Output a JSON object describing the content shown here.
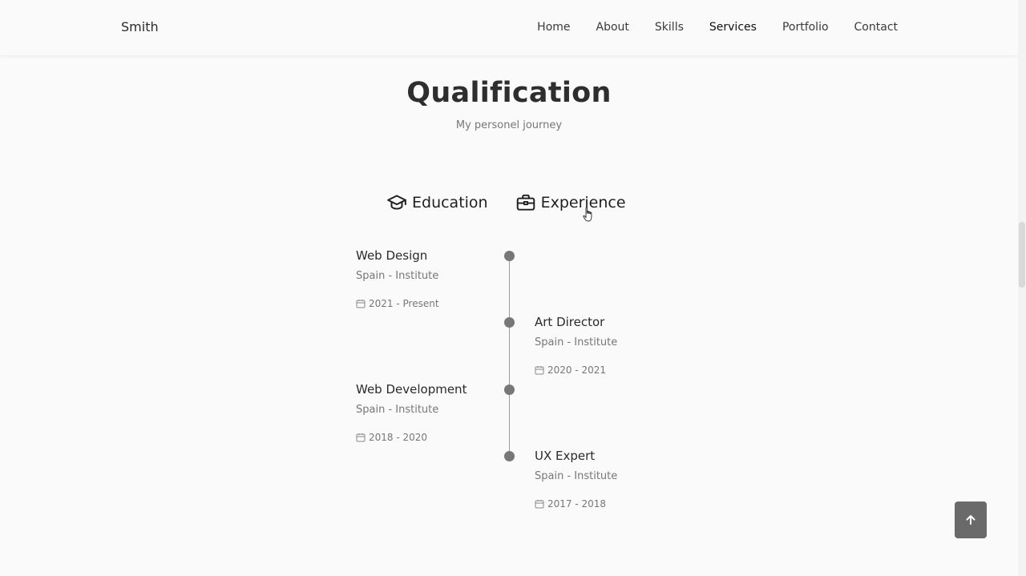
{
  "header": {
    "logo": "Smith",
    "nav": [
      {
        "label": "Home"
      },
      {
        "label": "About"
      },
      {
        "label": "Skills"
      },
      {
        "label": "Services",
        "active": true
      },
      {
        "label": "Portfolio"
      },
      {
        "label": "Contact"
      }
    ]
  },
  "section": {
    "title": "Qualification",
    "subtitle": "My personel journey"
  },
  "tabs": [
    {
      "label": "Education",
      "icon": "graduation-cap-icon"
    },
    {
      "label": "Experience",
      "icon": "briefcase-icon"
    }
  ],
  "timeline": [
    {
      "title": "Web Design",
      "subtitle": "Spain - Institute",
      "date": "2021 - Present",
      "side": "left"
    },
    {
      "title": "Art Director",
      "subtitle": "Spain - Institute",
      "date": "2020 - 2021",
      "side": "right"
    },
    {
      "title": "Web Development",
      "subtitle": "Spain - Institute",
      "date": "2018 - 2020",
      "side": "left"
    },
    {
      "title": "UX Expert",
      "subtitle": "Spain - Institute",
      "date": "2017 - 2018",
      "side": "right"
    }
  ],
  "scroll_up": {
    "icon": "arrow-up-icon"
  },
  "colors": {
    "background": "#fafafa",
    "timeline_dot": "#777777",
    "scroll_button": "#6a6a6a"
  }
}
